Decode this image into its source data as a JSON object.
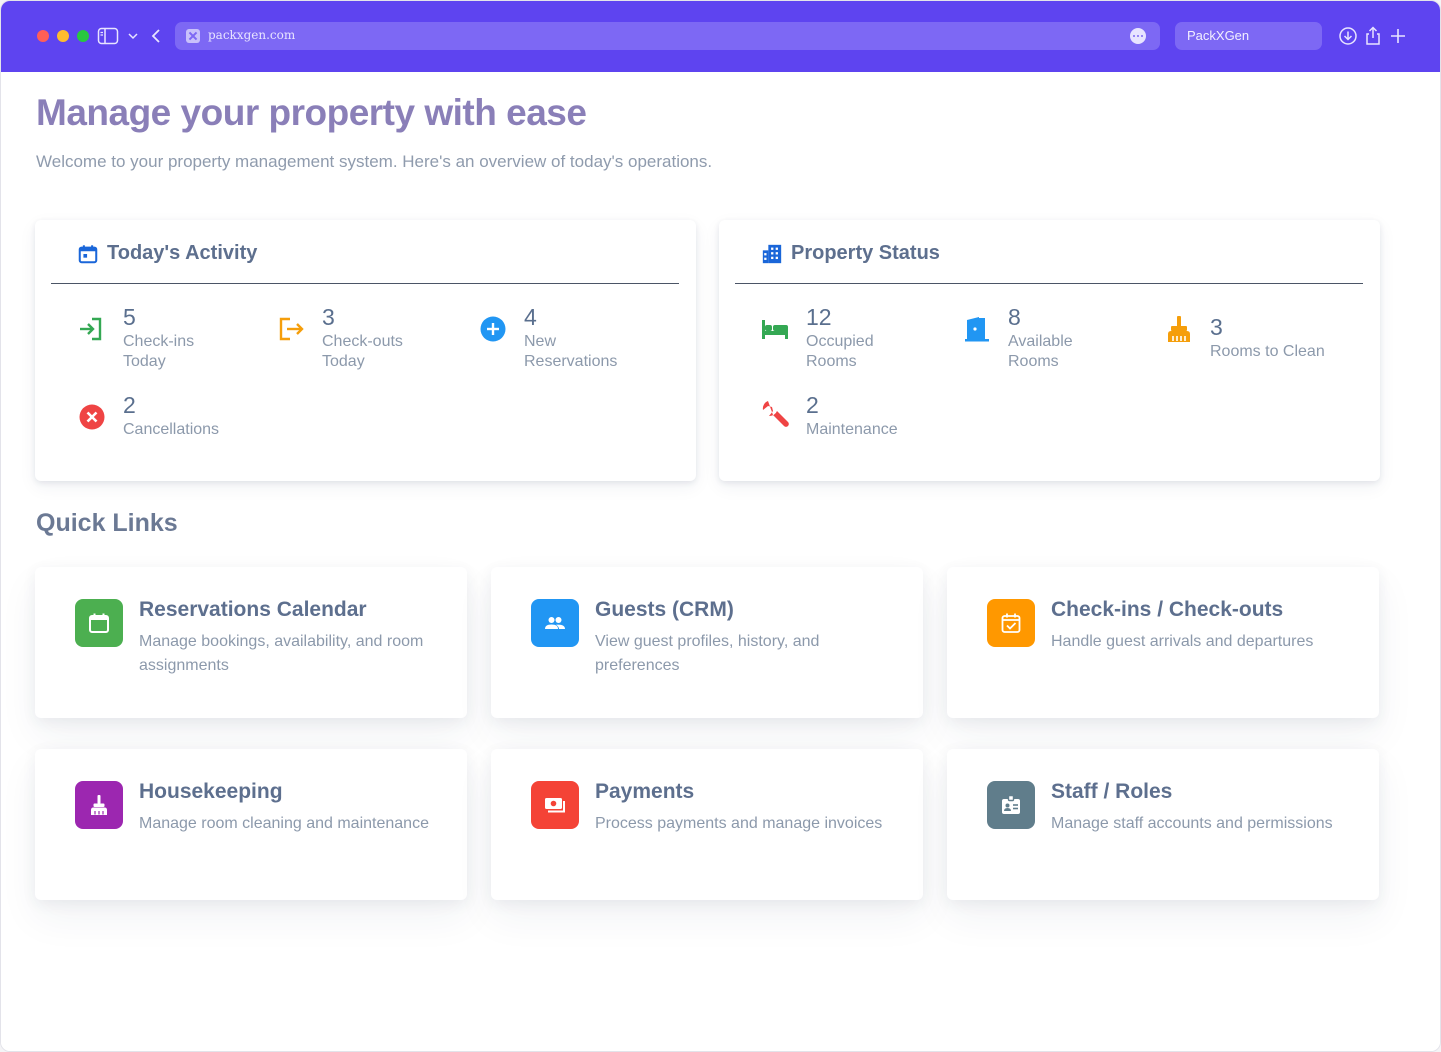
{
  "browser": {
    "url": "packxgen.com",
    "tab_title": "PackXGen",
    "accent": "#5e44f0"
  },
  "page": {
    "title": "Manage your property with ease",
    "subtitle": "Welcome to your property management system. Here's an overview of today's operations."
  },
  "activity": {
    "title": "Today's Activity",
    "icon": "calendar-icon",
    "stats": [
      {
        "value": "5",
        "label": "Check-ins Today",
        "icon": "login-icon",
        "color": "#34a853"
      },
      {
        "value": "3",
        "label": "Check-outs Today",
        "icon": "logout-icon",
        "color": "#f59e0b"
      },
      {
        "value": "4",
        "label": "New Reservations",
        "icon": "add-circle-icon",
        "color": "#2196f3"
      },
      {
        "value": "2",
        "label": "Cancellations",
        "icon": "cancel-icon",
        "color": "#ef4444"
      }
    ]
  },
  "property": {
    "title": "Property Status",
    "icon": "building-icon",
    "stats": [
      {
        "value": "12",
        "label": "Occupied Rooms",
        "icon": "bed-icon",
        "color": "#34a853"
      },
      {
        "value": "8",
        "label": "Available Rooms",
        "icon": "door-icon",
        "color": "#2196f3"
      },
      {
        "value": "3",
        "label": "Rooms to Clean",
        "icon": "broom-icon",
        "color": "#f59e0b"
      },
      {
        "value": "2",
        "label": "Maintenance",
        "icon": "wrench-icon",
        "color": "#ef4444"
      }
    ]
  },
  "quick_links": {
    "title": "Quick Links",
    "items": [
      {
        "title": "Reservations Calendar",
        "desc": "Manage bookings, availability, and room assignments",
        "icon": "calendar-icon",
        "color": "#4caf50"
      },
      {
        "title": "Guests (CRM)",
        "desc": "View guest profiles, history, and preferences",
        "icon": "people-icon",
        "color": "#2196f3"
      },
      {
        "title": "Check-ins / Check-outs",
        "desc": "Handle guest arrivals and departures",
        "icon": "calendar-check-icon",
        "color": "#ff9800"
      },
      {
        "title": "Housekeeping",
        "desc": "Manage room cleaning and maintenance",
        "icon": "broom-icon",
        "color": "#9c27b0"
      },
      {
        "title": "Payments",
        "desc": "Process payments and manage invoices",
        "icon": "payments-icon",
        "color": "#f44336"
      },
      {
        "title": "Staff / Roles",
        "desc": "Manage staff accounts and permissions",
        "icon": "badge-icon",
        "color": "#607d8b"
      }
    ]
  }
}
